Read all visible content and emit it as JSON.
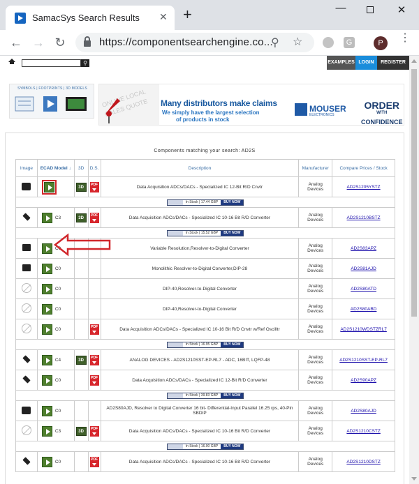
{
  "browser": {
    "tab_title": "SamacSys Search Results",
    "url": "https://componentsearchengine.co...",
    "avatar_letter": "P",
    "new_tab_symbol": "+",
    "close_symbol": "✕"
  },
  "topnav": {
    "examples": "EXAMPLES",
    "login": "LOGIN",
    "register": "REGISTER"
  },
  "banner": {
    "left_title": "SYMBOLS | FOOTPRINTS | 3D MODELS",
    "headline": "Many distributors make claims",
    "sub1": "We simply have the largest selection",
    "sub2": "of products in stock",
    "mouser": "MOUSER",
    "mouser_sub": "ELECTRONICS",
    "order1": "ORDER",
    "order2": "WITH",
    "order3": "CONFIDENCE"
  },
  "results": {
    "match_text": "Components matching your search: AD2S",
    "headers": {
      "image": "Image",
      "ecad": "ECAD Model ↓",
      "three_d": "3D",
      "ds": "D.S.",
      "description": "Description",
      "manufacturer": "Manufacturer",
      "compare": "Compare Prices / Stock"
    },
    "rows": [
      {
        "cl": "",
        "desc": "Data Acquisition ADCs/DACs - Specialized IC 12-Bit R/D Cnvtr",
        "mfr": "Analog Devices",
        "part": "AD2S1205YSTZ",
        "stock": "In Stock | 17.44 GBP"
      },
      {
        "cl": "C3",
        "desc": "Data Acquisition ADCs/DACs - Specialized IC 10-16 Bit R/D Converter",
        "mfr": "Analog Devices",
        "part": "AD2S1210BSTZ",
        "stock": "In Stock | 15.52 GBP"
      },
      {
        "cl": "C0",
        "desc": "Variable Resolution,Resolver-to-Digital Converter",
        "mfr": "Analog Devices",
        "part": "AD2S83APZ"
      },
      {
        "cl": "C0",
        "desc": "Monolithic Resolver-to-Digital Converter,DIP-28",
        "mfr": "Analog Devices",
        "part": "AD2S81AJD"
      },
      {
        "cl": "C0",
        "desc": "DIP-40,Resolver-to-Digital Converter",
        "mfr": "Analog Devices",
        "part": "AD2S80ATD"
      },
      {
        "cl": "C0",
        "desc": "DIP-40,Resolver-to-Digital Converter",
        "mfr": "Analog Devices",
        "part": "AD2S80ABD"
      },
      {
        "cl": "C0",
        "desc": "Data Acquisition ADCs/DACs - Specialized IC 10-16 Bit R/D Cnvtr w/Ref Oscilltr",
        "mfr": "Analog Devices",
        "part": "AD2S1210WDSTZRL7",
        "stock": "In Stock | 16.95 GBP"
      },
      {
        "cl": "C4",
        "desc": "ANALOG DEVICES - AD2S1210SST-EP-RL7 - ADC, 16BIT, LQFP-48",
        "mfr": "Analog Devices",
        "part": "AD2S1210SST-EP-RL7"
      },
      {
        "cl": "C0",
        "desc": "Data Acquisition ADCs/DACs - Specialized IC 12-Bit R/D Converter",
        "mfr": "Analog Devices",
        "part": "AD2S90APZ",
        "stock": "In Stock | 39.83 GBP"
      },
      {
        "cl": "C0",
        "desc": "AD2S80AJD, Resolver to Digital Converter 16 bit- Differential-Input Parallel 16.25 rps, 40-Pin SBDIP",
        "mfr": "Analog Devices",
        "part": "AD2S80AJD"
      },
      {
        "cl": "C3",
        "desc": "Data Acquisition ADCs/DACs - Specialized IC 10-16 Bit R/D Converter",
        "mfr": "Analog Devices",
        "part": "AD2S1210CSTZ",
        "stock": "In Stock | 16.00 GBP"
      },
      {
        "cl": "C0",
        "desc": "Data Acquisition ADCs/DACs - Specialized IC 10-16 Bit R/D Converter",
        "mfr": "Analog Devices",
        "part": "AD2S1210DSTZ"
      }
    ],
    "three_d_label": "3D",
    "pdf_label": "PDF",
    "buy_label": "BUY NOW"
  }
}
